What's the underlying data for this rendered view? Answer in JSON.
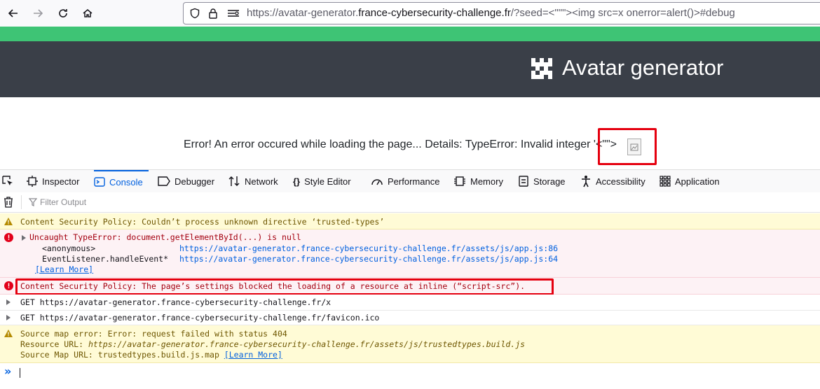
{
  "browser": {
    "url_prefix": "https://avatar-generator.",
    "url_domain": "france-cybersecurity-challenge.fr",
    "url_suffix": "/?seed=<\"\"\"><img src=x onerror=alert()>#debug"
  },
  "page": {
    "title": "Avatar generator",
    "error_text": "Error! An error occured while loading the page... Details: TypeError: Invalid integer '<\"\">",
    "error_tail": "'"
  },
  "devtools": {
    "tabs": [
      "Inspector",
      "Console",
      "Debugger",
      "Network",
      "Style Editor",
      "Performance",
      "Memory",
      "Storage",
      "Accessibility",
      "Application"
    ],
    "active_tab": "Console",
    "filter_placeholder": "Filter Output"
  },
  "console": {
    "csp_warning": "Content Security Policy: Couldn’t process unknown directive ‘trusted-types’",
    "uncaught": "Uncaught TypeError: document.getElementById(...) is null",
    "stack1_fn": "<anonymous>",
    "stack1_url": "https://avatar-generator.france-cybersecurity-challenge.fr/assets/js/app.js",
    "stack1_line": ":86",
    "stack2_fn": "EventListener.handleEvent*",
    "stack2_url": "https://avatar-generator.france-cybersecurity-challenge.fr/assets/js/app.js",
    "stack2_line": ":64",
    "learn_more": "[Learn More]",
    "csp_error": "Content Security Policy: The page’s settings blocked the loading of a resource at inline (“script-src”).",
    "get1": "GET https://avatar-generator.france-cybersecurity-challenge.fr/x",
    "get2": "GET https://avatar-generator.france-cybersecurity-challenge.fr/favicon.ico",
    "sourcemap1": "Source map error: Error: request failed with status 404",
    "sourcemap2_label": "Resource URL: ",
    "sourcemap2_url": "https://avatar-generator.france-cybersecurity-challenge.fr/assets/js/trustedtypes.build.js",
    "sourcemap3_label": "Source Map URL: trustedtypes.build.js.map ",
    "prompt_symbol": "»"
  }
}
